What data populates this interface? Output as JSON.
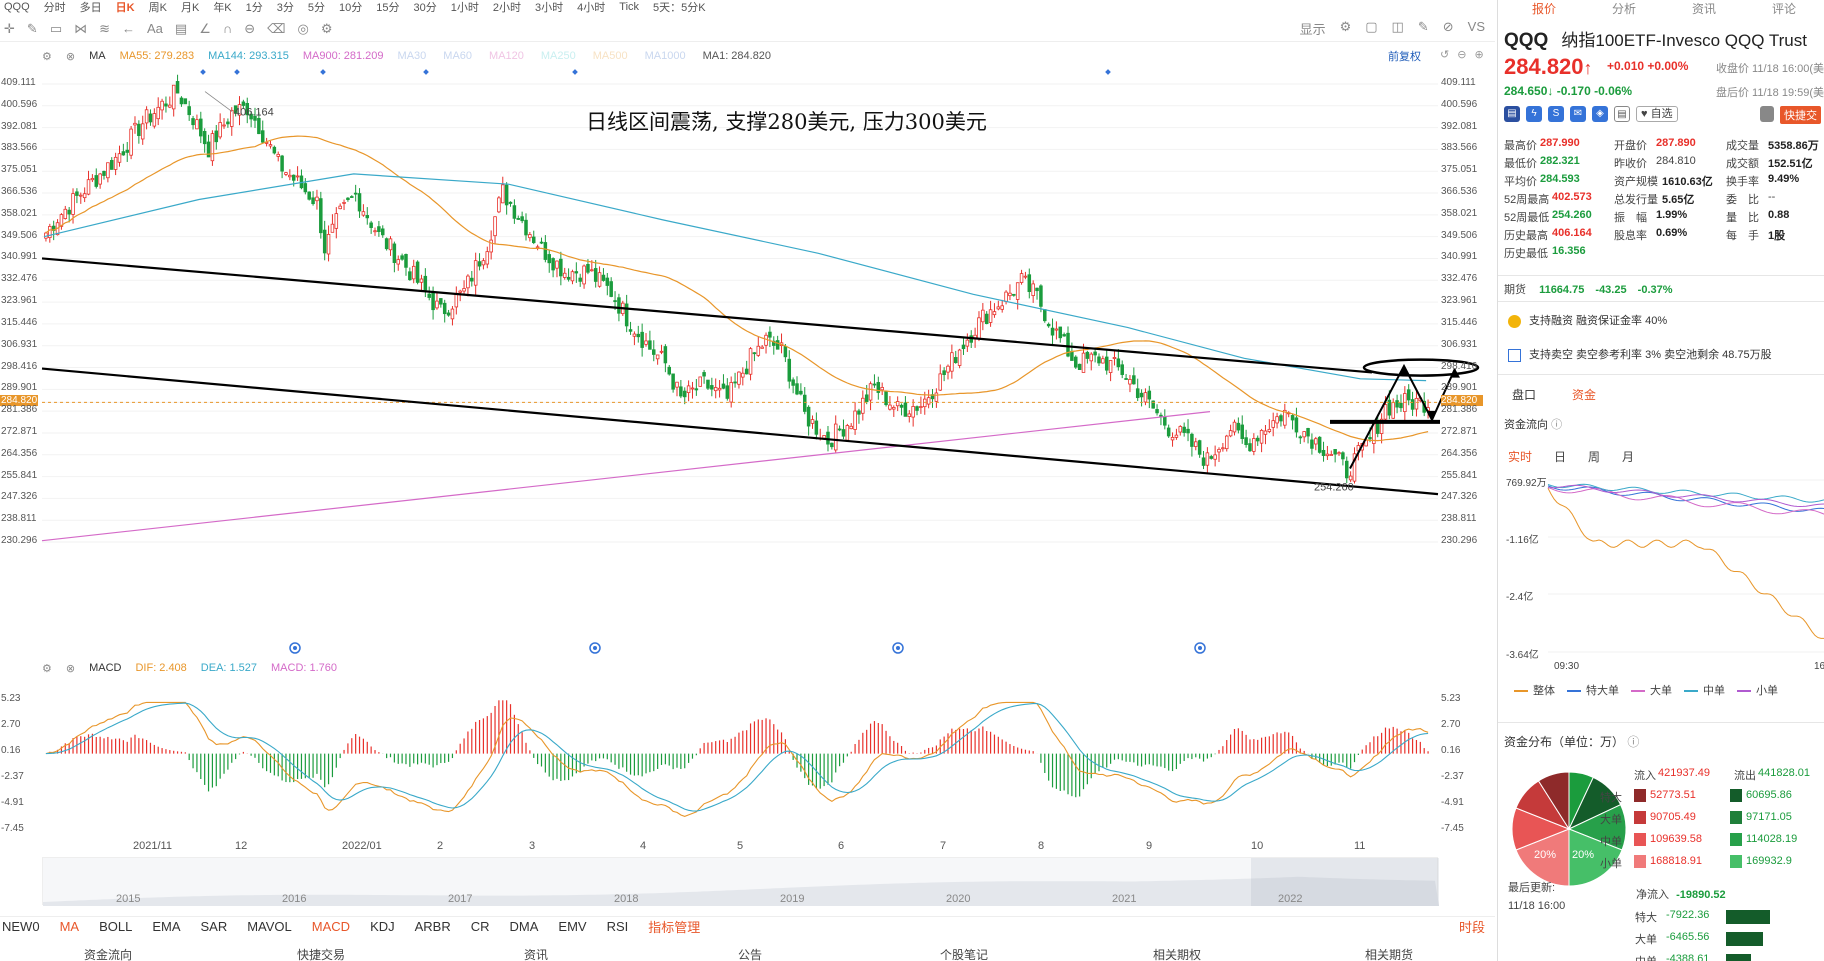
{
  "topbar": {
    "items": [
      "QQQ",
      "分时",
      "多日",
      "日K",
      "周K",
      "月K",
      "年K",
      "1分",
      "3分",
      "5分",
      "10分",
      "15分",
      "30分",
      "1小时",
      "2小时",
      "3小时",
      "4小时",
      "Tick",
      "5天：5分K"
    ],
    "active": "日K"
  },
  "toolbar": {
    "display_label": "显示",
    "icons": [
      "crosshair-icon",
      "pen-icon",
      "rect-icon",
      "fib-icon",
      "brush-icon",
      "undo-arrow-icon",
      "text-icon",
      "comment-icon",
      "ruler-icon",
      "magnet-icon",
      "lock-icon",
      "trash-icon",
      "eye-icon",
      "gear-icon"
    ]
  },
  "ma_bar": {
    "type_label": "MA",
    "items": [
      {
        "label": "MA55:",
        "value": "279.283",
        "color": "#e8962a"
      },
      {
        "label": "MA144:",
        "value": "293.315",
        "color": "#3aa9c9"
      },
      {
        "label": "MA900:",
        "value": "281.209",
        "color": "#d46ac8"
      },
      {
        "label": "MA30",
        "value": "",
        "color": "#c9d7ef"
      },
      {
        "label": "MA60",
        "value": "",
        "color": "#c9d7ef"
      },
      {
        "label": "MA120",
        "value": "",
        "color": "#f0c5e4"
      },
      {
        "label": "MA250",
        "value": "",
        "color": "#c9eff0"
      },
      {
        "label": "MA500",
        "value": "",
        "color": "#f7e2c4"
      },
      {
        "label": "MA1000",
        "value": "",
        "color": "#c9d7ef"
      },
      {
        "label": "MA1:",
        "value": "284.820",
        "color": "#555555"
      }
    ],
    "fuquan": "前复权"
  },
  "annotation": "日线区间震荡, 支撑280美元, 压力300美元",
  "price_axis": [
    "409.111",
    "400.596",
    "392.081",
    "383.566",
    "375.051",
    "366.536",
    "358.021",
    "349.506",
    "340.991",
    "332.476",
    "323.961",
    "315.446",
    "306.931",
    "298.416",
    "289.901",
    "284.820",
    "281.386",
    "272.871",
    "264.356",
    "255.841",
    "247.326",
    "238.811",
    "230.296"
  ],
  "price_axis_right": [
    "409.111",
    "400.596",
    "392.081",
    "383.566",
    "375.051",
    "366.536",
    "358.021",
    "349.506",
    "340.991",
    "332.476",
    "323.961",
    "315.446",
    "306.931",
    "298.416",
    "289.901",
    "284.820",
    "281.386",
    "272.871",
    "264.356",
    "255.841",
    "247.326",
    "238.811",
    "230.296"
  ],
  "high_label": "406.164",
  "low_label": "254.260",
  "macd_bar": {
    "label": "MACD",
    "items": [
      {
        "label": "DIF:",
        "value": "2.408",
        "color": "#e8962a"
      },
      {
        "label": "DEA:",
        "value": "1.527",
        "color": "#3aa9c9"
      },
      {
        "label": "MACD:",
        "value": "1.760",
        "color": "#d46ac8"
      }
    ]
  },
  "macd_axis": [
    "5.23",
    "2.70",
    "0.16",
    "-2.37",
    "-4.91",
    "-7.45"
  ],
  "x_axis": [
    "2021/11",
    "12",
    "2022/01",
    "2",
    "3",
    "4",
    "5",
    "6",
    "7",
    "8",
    "9",
    "10",
    "11"
  ],
  "overview_years": [
    "2015",
    "2016",
    "2017",
    "2018",
    "2019",
    "2020",
    "2021",
    "2022"
  ],
  "indicators": {
    "items": [
      "NEW0",
      "MA",
      "BOLL",
      "EMA",
      "SAR",
      "MAVOL",
      "MACD",
      "KDJ",
      "ARBR",
      "CR",
      "DMA",
      "EMV",
      "RSI",
      "指标管理"
    ],
    "active": [
      "MA",
      "MACD",
      "指标管理"
    ],
    "right": "时段"
  },
  "bottom_nav": [
    "资金流向",
    "快捷交易",
    "资讯",
    "公告",
    "个股笔记",
    "相关期权",
    "相关期货"
  ],
  "right_panel": {
    "tabs": [
      "报价",
      "分析",
      "资讯",
      "评论"
    ],
    "code": "QQQ",
    "name": "纳指100ETF-Invesco QQQ Trust",
    "price": "284.820",
    "change": "+0.010 +0.00%",
    "close_time": "收盘价 11/18 16:00(美",
    "after_price": "284.650↓ -0.170 -0.06%",
    "after_time": "盘后价 11/18 19:59(美",
    "zixuan": "自选",
    "quick_trade": "快捷交",
    "quote_rows": [
      [
        {
          "l": "最高价",
          "v": "287.990",
          "c": "up"
        },
        {
          "l": "开盘价",
          "v": "287.890",
          "c": "up"
        },
        {
          "l": "成交量",
          "v": "5358.86万",
          "c": "nt"
        }
      ],
      [
        {
          "l": "最低价",
          "v": "282.321",
          "c": "dn"
        },
        {
          "l": "昨收价",
          "v": "284.810",
          "c": "lbl"
        },
        {
          "l": "成交额",
          "v": "152.51亿",
          "c": "nt"
        }
      ],
      [
        {
          "l": "平均价",
          "v": "284.593",
          "c": "dn"
        },
        {
          "l": "资产规模",
          "v": "1610.63亿",
          "c": "nt"
        },
        {
          "l": "换手率",
          "v": "9.49%",
          "c": "nt"
        }
      ],
      [
        {
          "l": "52周最高",
          "v": "402.573",
          "c": "up"
        },
        {
          "l": "总发行量",
          "v": "5.65亿",
          "c": "nt"
        },
        {
          "l": "委　比",
          "v": "--",
          "c": "lbl"
        }
      ],
      [
        {
          "l": "52周最低",
          "v": "254.260",
          "c": "dn"
        },
        {
          "l": "振　幅",
          "v": "1.99%",
          "c": "nt"
        },
        {
          "l": "量　比",
          "v": "0.88",
          "c": "nt"
        }
      ],
      [
        {
          "l": "历史最高",
          "v": "406.164",
          "c": "up"
        },
        {
          "l": "股息率",
          "v": "0.69%",
          "c": "nt"
        },
        {
          "l": "每　手",
          "v": "1股",
          "c": "nt"
        }
      ],
      [
        {
          "l": "历史最低",
          "v": "16.356",
          "c": "dn"
        }
      ]
    ],
    "futures_label": "期货",
    "futures_value": "11664.75",
    "futures_change": "-43.25",
    "futures_pct": "-0.37%",
    "margin": "支持融资  融资保证金率 40%",
    "short": "支持卖空  卖空参考利率 3%  卖空池剩余 48.75万股",
    "subtabs": [
      "盘口",
      "资金"
    ],
    "flow_title": "资金流向",
    "periods": [
      "实时",
      "日",
      "周",
      "月"
    ],
    "flow_axis": [
      "769.92万",
      "-1.16亿",
      "-2.4亿",
      "-3.64亿"
    ],
    "flow_time_start": "09:30",
    "flow_time_end": "16",
    "legend": [
      {
        "name": "整体",
        "color": "#e8962a"
      },
      {
        "name": "特大单",
        "color": "#3573d8"
      },
      {
        "name": "大单",
        "color": "#d46ac8"
      },
      {
        "name": "中单",
        "color": "#3aa9c9"
      },
      {
        "name": "小单",
        "color": "#b05ad0"
      }
    ],
    "dist_title": "资金分布（单位：万）",
    "inflow_label": "流入",
    "inflow_total": "421937.49",
    "outflow_label": "流出",
    "outflow_total": "441828.01",
    "dist_rows": [
      {
        "label": "特大",
        "in": "52773.51",
        "out": "60695.86",
        "in_color": "#8e2a2a",
        "out_color": "#145c2a"
      },
      {
        "label": "大单",
        "in": "90705.49",
        "out": "97171.05",
        "in_color": "#c53a3a",
        "out_color": "#1f7f3a"
      },
      {
        "label": "中单",
        "in": "109639.58",
        "out": "114028.19",
        "in_color": "#e85555",
        "out_color": "#27a04a"
      },
      {
        "label": "小单",
        "in": "168818.91",
        "out": "169932.9",
        "in_color": "#f07a7a",
        "out_color": "#46bf68"
      }
    ],
    "pie_labels": [
      "20%",
      "20%"
    ],
    "last_update_label": "最后更新:",
    "last_update_time": "11/18 16:00",
    "net_label": "净流入",
    "net_total": "-19890.52",
    "net_rows": [
      {
        "label": "特大",
        "value": "-7922.36"
      },
      {
        "label": "大单",
        "value": "-6465.56"
      },
      {
        "label": "中单",
        "value": "-4388.61"
      }
    ]
  }
}
